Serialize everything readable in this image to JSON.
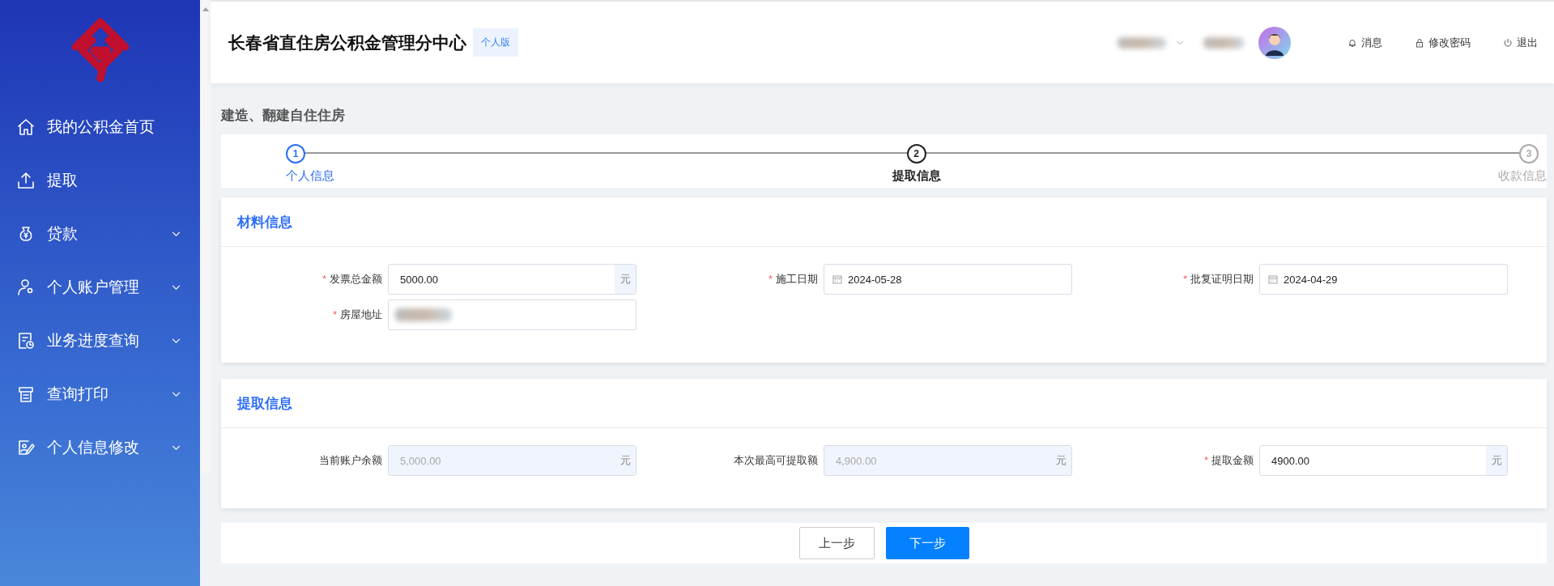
{
  "sidebar": {
    "items": [
      {
        "label": "我的公积金首页",
        "expandable": false
      },
      {
        "label": "提取",
        "expandable": false
      },
      {
        "label": "贷款",
        "expandable": true
      },
      {
        "label": "个人账户管理",
        "expandable": true
      },
      {
        "label": "业务进度查询",
        "expandable": true
      },
      {
        "label": "查询打印",
        "expandable": true
      },
      {
        "label": "个人信息修改",
        "expandable": true
      }
    ]
  },
  "header": {
    "title": "长春省直住房公积金管理分中心",
    "badge": "个人版",
    "links": [
      "消息",
      "修改密码",
      "退出"
    ]
  },
  "page_title": "建造、翻建自住住房",
  "steps": [
    {
      "number": "1",
      "label": "个人信息",
      "kind": "done"
    },
    {
      "number": "2",
      "label": "提取信息",
      "kind": "active"
    },
    {
      "number": "3",
      "label": "收款信息",
      "kind": "pending"
    }
  ],
  "sections": [
    {
      "title": "材料信息",
      "fields": [
        {
          "label": "发票总金额",
          "required_mark": "*",
          "kind": "amount",
          "value": "5000.00",
          "unit": "元",
          "disabled": false
        },
        {
          "label": "施工日期",
          "required_mark": "*",
          "kind": "date",
          "value": "2024-05-28",
          "disabled": false
        },
        {
          "label": "批复证明日期",
          "required_mark": "*",
          "kind": "date",
          "value": "2024-04-29",
          "disabled": false
        },
        {
          "label": "房屋地址",
          "required_mark": "*",
          "kind": "redacted",
          "disabled": false
        }
      ]
    },
    {
      "title": "提取信息",
      "fields": [
        {
          "label": "当前账户余额",
          "kind": "amount",
          "value": "5,000.00",
          "unit": "元",
          "disabled": true
        },
        {
          "label": "本次最高可提取额",
          "kind": "amount",
          "value": "4,900.00",
          "unit": "元",
          "disabled": true
        },
        {
          "label": "提取金额",
          "required_mark": "*",
          "kind": "amount",
          "value": "4900.00",
          "unit": "元",
          "disabled": false
        }
      ]
    }
  ],
  "buttons": [
    {
      "label": "上一步",
      "kind": "secondary"
    },
    {
      "label": "下一步",
      "kind": "primary"
    }
  ]
}
